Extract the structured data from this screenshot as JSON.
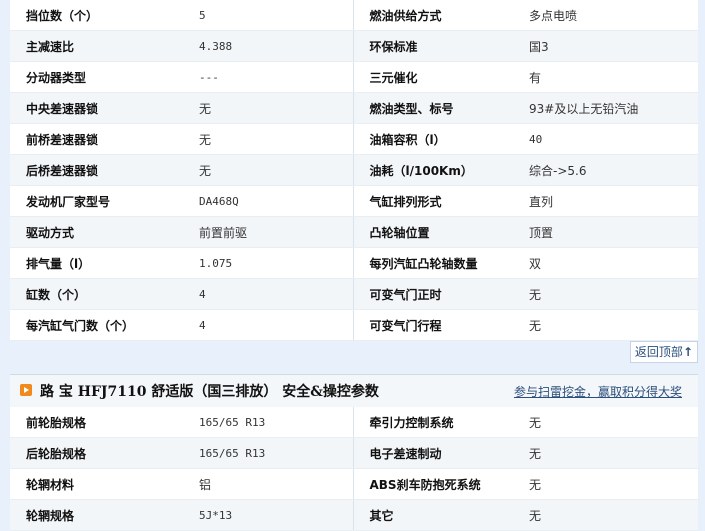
{
  "table1": {
    "rows": [
      {
        "k1": "挡位数（个）",
        "v1": "5",
        "k2": "燃油供给方式",
        "v2": "多点电喷"
      },
      {
        "k1": "主减速比",
        "v1": "4.388",
        "k2": "环保标准",
        "v2": "国3"
      },
      {
        "k1": "分动器类型",
        "v1": "---",
        "k2": "三元催化",
        "v2": "有"
      },
      {
        "k1": "中央差速器锁",
        "v1": "无",
        "k2": "燃油类型、标号",
        "v2": "93#及以上无铅汽油"
      },
      {
        "k1": "前桥差速器锁",
        "v1": "无",
        "k2": "油箱容积（l）",
        "v2": "40"
      },
      {
        "k1": "后桥差速器锁",
        "v1": "无",
        "k2": "油耗（l/100Km）",
        "v2": "综合->5.6"
      },
      {
        "k1": "发动机厂家型号",
        "v1": "DA468Q",
        "k2": "气缸排列形式",
        "v2": "直列"
      },
      {
        "k1": "驱动方式",
        "v1": "前置前驱",
        "k2": "凸轮轴位置",
        "v2": "顶置"
      },
      {
        "k1": "排气量（l）",
        "v1": "1.075",
        "k2": "每列汽缸凸轮轴数量",
        "v2": "双"
      },
      {
        "k1": "缸数（个）",
        "v1": "4",
        "k2": "可变气门正时",
        "v2": "无"
      },
      {
        "k1": "每汽缸气门数（个）",
        "v1": "4",
        "k2": "可变气门行程",
        "v2": "无"
      }
    ]
  },
  "back_to_top": {
    "label": "返回顶部",
    "arrow": "↑"
  },
  "section2": {
    "title": "路 宝 HFJ7110 舒适版（国三排放） 安全&操控参数",
    "promo_link": "参与扫雷挖金，赢取积分得大奖"
  },
  "table2": {
    "rows": [
      {
        "k1": "前轮胎规格",
        "v1": "165/65 R13",
        "k2": "牵引力控制系统",
        "v2": "无"
      },
      {
        "k1": "后轮胎规格",
        "v1": "165/65 R13",
        "k2": "电子差速制动",
        "v2": "无"
      },
      {
        "k1": "轮辋材料",
        "v1": "铝",
        "k2": "ABS刹车防抱死系统",
        "v2": "无"
      },
      {
        "k1": "轮辋规格",
        "v1": "5J*13",
        "k2": "其它",
        "v2": "无"
      }
    ]
  },
  "colors": {
    "accent_orange": "#f08a1c",
    "link_blue": "#2b4e7a",
    "page_bg": "#e8f1fb"
  }
}
